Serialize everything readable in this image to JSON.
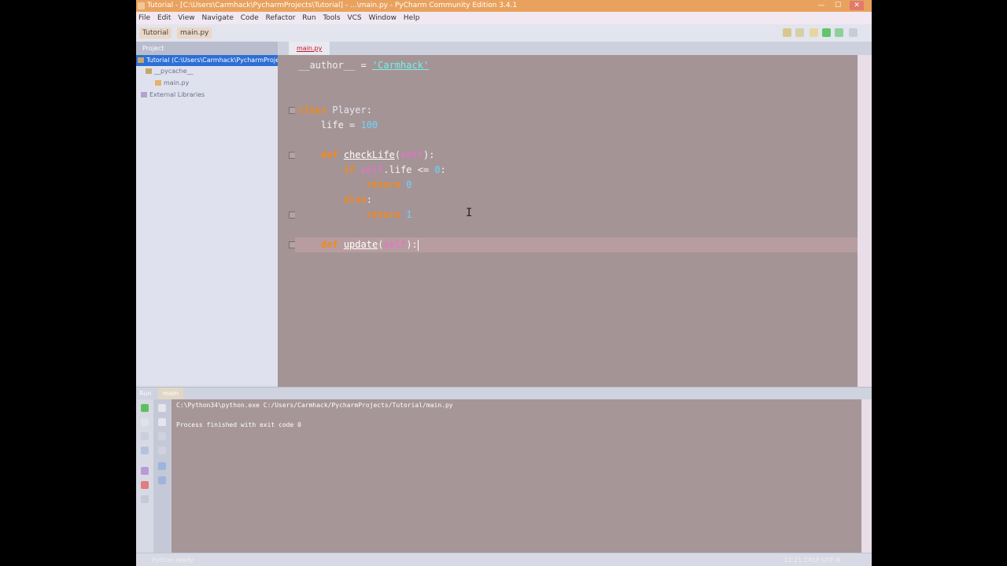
{
  "window": {
    "title": "Tutorial - [C:\\Users\\Carmhack\\PycharmProjects\\Tutorial] - ...\\main.py - PyCharm Community Edition 3.4.1",
    "controls": [
      "—",
      "☐",
      "✕"
    ]
  },
  "menubar": {
    "items": [
      "File",
      "Edit",
      "View",
      "Navigate",
      "Code",
      "Refactor",
      "Run",
      "Tools",
      "VCS",
      "Window",
      "Help"
    ]
  },
  "navbar": {
    "breadcrumb_project": "Tutorial",
    "breadcrumb_file": "main.py"
  },
  "project_panel": {
    "header": "Project",
    "items": [
      {
        "label": "Tutorial (C:\\Users\\Carmhack\\PycharmProjects\\Tutorial)",
        "selected": true
      },
      {
        "label": "__pycache__",
        "selected": false
      },
      {
        "label": "main.py",
        "selected": false
      },
      {
        "label": "External Libraries",
        "selected": false
      }
    ]
  },
  "editor": {
    "tab_label": "main.py",
    "lines": [
      {
        "tokens": [
          {
            "t": "__author__",
            "c": "dunder"
          },
          {
            "t": " = ",
            "c": "plain"
          },
          {
            "t": "'Carmhack'",
            "c": "str"
          }
        ]
      },
      {
        "tokens": []
      },
      {
        "tokens": []
      },
      {
        "tokens": [
          {
            "t": "class",
            "c": "kw"
          },
          {
            "t": " ",
            "c": "plain"
          },
          {
            "t": "Player",
            "c": "cls"
          },
          {
            "t": ":",
            "c": "plain"
          }
        ]
      },
      {
        "tokens": [
          {
            "t": "    life = ",
            "c": "plain"
          },
          {
            "t": "100",
            "c": "num"
          }
        ]
      },
      {
        "tokens": []
      },
      {
        "tokens": [
          {
            "t": "    ",
            "c": "plain"
          },
          {
            "t": "def",
            "c": "kw"
          },
          {
            "t": " ",
            "c": "plain"
          },
          {
            "t": "checkLife",
            "c": "fn"
          },
          {
            "t": "(",
            "c": "plain"
          },
          {
            "t": "self",
            "c": "self"
          },
          {
            "t": "):",
            "c": "plain"
          }
        ]
      },
      {
        "tokens": [
          {
            "t": "        ",
            "c": "plain"
          },
          {
            "t": "if",
            "c": "kw"
          },
          {
            "t": " ",
            "c": "plain"
          },
          {
            "t": "self",
            "c": "self"
          },
          {
            "t": ".life <= ",
            "c": "plain"
          },
          {
            "t": "0",
            "c": "num"
          },
          {
            "t": ":",
            "c": "plain"
          }
        ]
      },
      {
        "tokens": [
          {
            "t": "            ",
            "c": "plain"
          },
          {
            "t": "return",
            "c": "kw"
          },
          {
            "t": " ",
            "c": "plain"
          },
          {
            "t": "0",
            "c": "num"
          }
        ]
      },
      {
        "tokens": [
          {
            "t": "        ",
            "c": "plain"
          },
          {
            "t": "else",
            "c": "kw"
          },
          {
            "t": ":",
            "c": "plain"
          }
        ]
      },
      {
        "tokens": [
          {
            "t": "            ",
            "c": "plain"
          },
          {
            "t": "return",
            "c": "kw"
          },
          {
            "t": " ",
            "c": "plain"
          },
          {
            "t": "1",
            "c": "num"
          }
        ]
      },
      {
        "tokens": []
      },
      {
        "tokens": [
          {
            "t": "    ",
            "c": "plain"
          },
          {
            "t": "def",
            "c": "kw"
          },
          {
            "t": " ",
            "c": "plain"
          },
          {
            "t": "update",
            "c": "fn"
          },
          {
            "t": "(",
            "c": "plain"
          },
          {
            "t": "self",
            "c": "self"
          },
          {
            "t": "):",
            "c": "plain"
          }
        ],
        "current": true
      }
    ]
  },
  "run_panel": {
    "header_label": "Run",
    "tab_label": "main",
    "output": [
      "C:\\Python34\\python.exe C:/Users/Carmhack/PycharmProjects/Tutorial/main.py",
      "",
      "Process finished with exit code 0"
    ]
  },
  "statusbar": {
    "message": "Python ready",
    "position": "13:21   CRLF   UTF-8"
  },
  "colors": {
    "titlebar": "#e9a25e",
    "editor_bg": "#a59496",
    "selection": "#2c6fd5",
    "keyword": "#ef8a1f",
    "self": "#f06bd6",
    "number": "#69d6ff",
    "string": "#6ff4ea"
  }
}
